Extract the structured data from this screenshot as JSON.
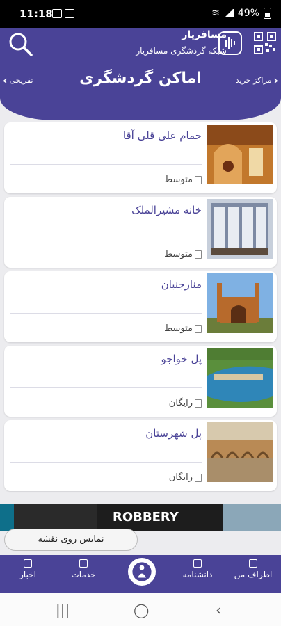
{
  "status": {
    "time": "11:18",
    "battery": "49%"
  },
  "header": {
    "brand_title": "مسافریار",
    "brand_subtitle": "شبکه گردشگری مسافریار",
    "page_title": "اماکن گردشگری",
    "nav_left": "تفریحی",
    "nav_right": "مراکز خرید"
  },
  "places": [
    {
      "name": "حمام علی قلی آقا",
      "price": "متوسط"
    },
    {
      "name": "خانه مشیرالملک",
      "price": "متوسط"
    },
    {
      "name": "منارجنبان",
      "price": "متوسط"
    },
    {
      "name": "پل خواجو",
      "price": "رایگان"
    },
    {
      "name": "پل شهرستان",
      "price": "رایگان"
    }
  ],
  "banner": {
    "text": "ROBBERY"
  },
  "map_button": "نمایش روی نقشه",
  "bottom_nav": {
    "nearby": "اطراف من",
    "encyclopedia": "دانشنامه",
    "services": "خدمات",
    "news": "اخبار"
  },
  "colors": {
    "primary": "#4a4397",
    "background": "#ececef"
  }
}
